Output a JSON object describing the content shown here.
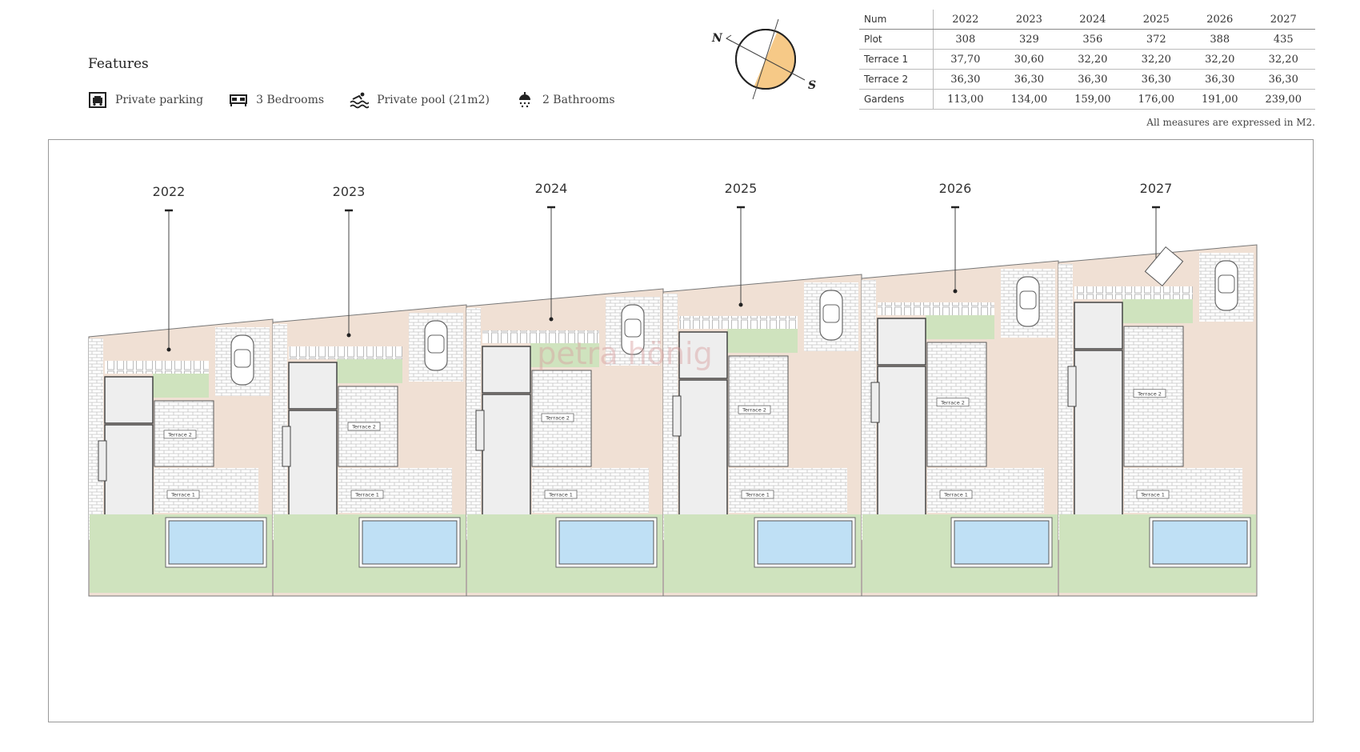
{
  "features": {
    "title": "Features",
    "items": [
      {
        "icon": "parking-icon",
        "label": "Private parking"
      },
      {
        "icon": "bed-icon",
        "label": "3 Bedrooms"
      },
      {
        "icon": "pool-icon",
        "label": "Private pool (21m2)"
      },
      {
        "icon": "shower-icon",
        "label": "2 Bathrooms"
      }
    ]
  },
  "compass": {
    "north": "N",
    "south": "S",
    "sun_color": "#f6c987"
  },
  "table": {
    "headers": [
      "Num",
      "2022",
      "2023",
      "2024",
      "2025",
      "2026",
      "2027"
    ],
    "rows": [
      {
        "label": "Plot",
        "values": [
          "308",
          "329",
          "356",
          "372",
          "388",
          "435"
        ]
      },
      {
        "label": "Terrace 1",
        "values": [
          "37,70",
          "30,60",
          "32,20",
          "32,20",
          "32,20",
          "32,20"
        ]
      },
      {
        "label": "Terrace 2",
        "values": [
          "36,30",
          "36,30",
          "36,30",
          "36,30",
          "36,30",
          "36,30"
        ]
      },
      {
        "label": "Gardens",
        "values": [
          "113,00",
          "134,00",
          "159,00",
          "176,00",
          "191,00",
          "239,00"
        ]
      }
    ],
    "note": "All measures are expressed in M2."
  },
  "plan": {
    "units": [
      "2022",
      "2023",
      "2024",
      "2025",
      "2026",
      "2027"
    ],
    "terrace1_label": "Terrace 1",
    "terrace2_label": "Terrace 2",
    "watermark": "petra hönig",
    "colors": {
      "yard": "#f0e0d4",
      "garden": "#cfe3be",
      "pool": "#bfe0f5",
      "building": "#eeeeee",
      "brick": "#cccccc"
    }
  }
}
